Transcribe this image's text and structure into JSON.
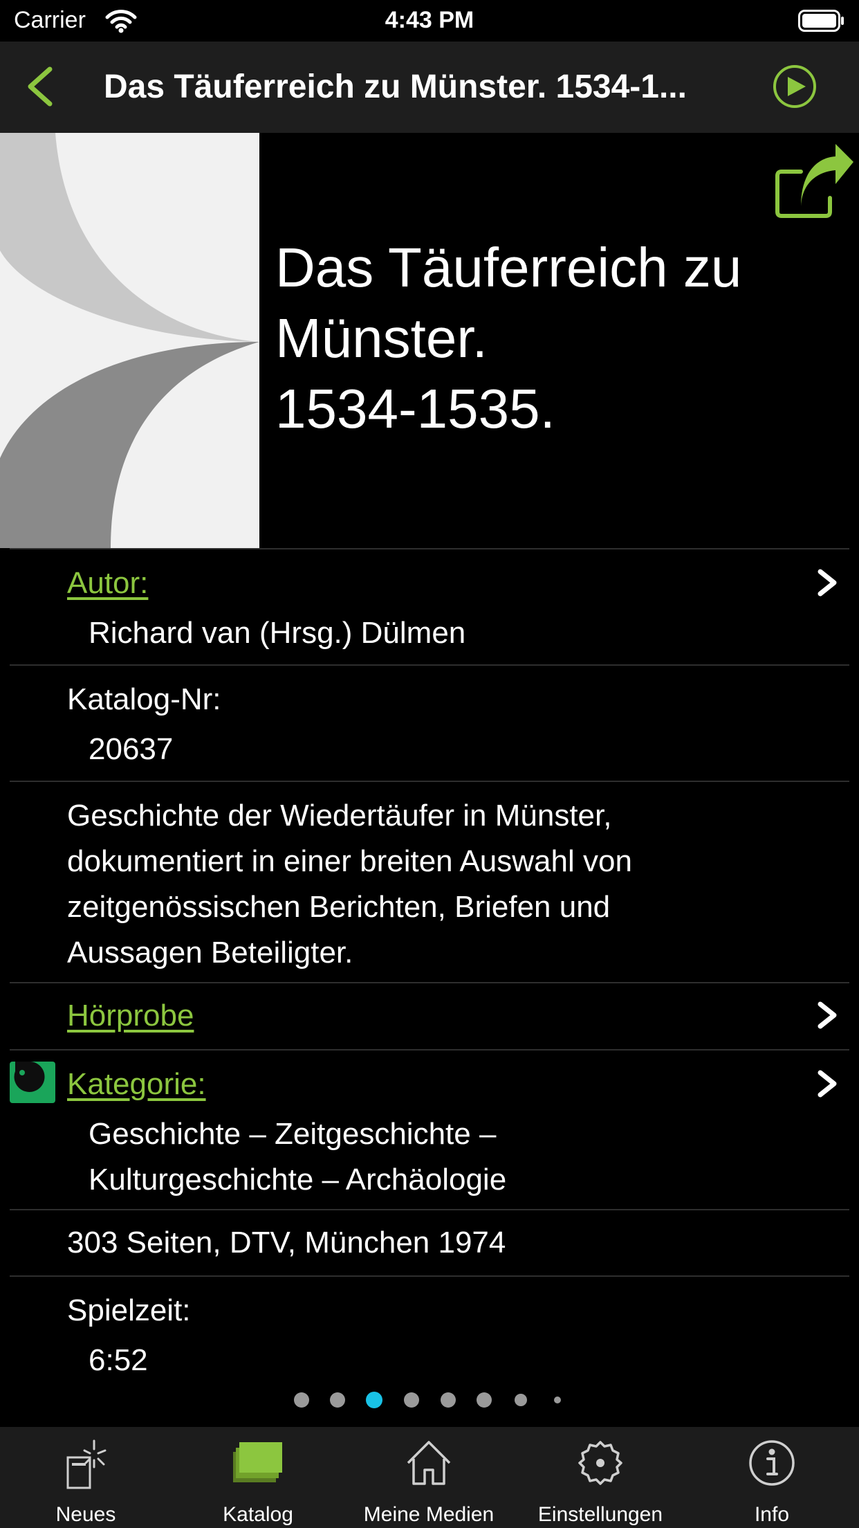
{
  "status_bar": {
    "carrier": "Carrier",
    "time": "4:43 PM"
  },
  "nav": {
    "title": "Das Täuferreich zu Münster. 1534-1..."
  },
  "book": {
    "title_lines": [
      "Das Täuferreich zu",
      "Münster.",
      "1534-1535."
    ]
  },
  "details": {
    "author_label": "Autor:",
    "author_value": "Richard van (Hrsg.) Dülmen",
    "catalog_label": "Katalog-Nr:",
    "catalog_value": "20637",
    "description_lines": [
      "Geschichte der Wiedertäufer in Münster,",
      "dokumentiert in einer breiten Auswahl von",
      "zeitgenössischen Berichten, Briefen und",
      "Aussagen Beteiligter."
    ],
    "sample_label": "Hörprobe",
    "category_label": "Kategorie:",
    "category_lines": [
      "Geschichte – Zeitgeschichte –",
      "Kulturgeschichte – Archäologie"
    ],
    "publication": "303 Seiten, DTV, München 1974",
    "playtime_label": "Spielzeit:",
    "playtime_value": "6:52"
  },
  "page_indicator": {
    "count": 8,
    "active_index": 2
  },
  "tabs": [
    {
      "label": "Neues",
      "icon": "new-items-icon"
    },
    {
      "label": "Katalog",
      "icon": "catalog-icon",
      "selected": true
    },
    {
      "label": "Meine Medien",
      "icon": "home-icon"
    },
    {
      "label": "Einstellungen",
      "icon": "gear-icon"
    },
    {
      "label": "Info",
      "icon": "info-icon"
    }
  ],
  "colors": {
    "accent": "#8cc63f",
    "page_dot_active": "#19c2e6",
    "category_badge": "#1aa55a"
  }
}
